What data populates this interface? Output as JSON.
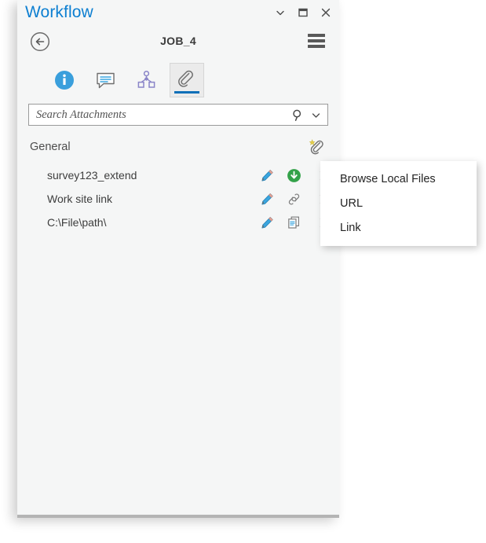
{
  "window": {
    "app_title": "Workflow",
    "controls": [
      {
        "name": "minimize",
        "glyph": "chevron-down"
      },
      {
        "name": "restore",
        "glyph": "square"
      },
      {
        "name": "close",
        "glyph": "x"
      }
    ]
  },
  "job_header": {
    "back_label": "Back",
    "job_title": "JOB_4",
    "menu_label": "Menu"
  },
  "tabs": [
    {
      "id": "information",
      "icon": "info-icon",
      "label": "Information",
      "active": false
    },
    {
      "id": "comments",
      "icon": "comment-icon",
      "label": "Comments",
      "active": false
    },
    {
      "id": "workflow",
      "icon": "workflow-diagram-icon",
      "label": "Workflow",
      "active": false
    },
    {
      "id": "attachments",
      "icon": "paperclip-icon",
      "label": "Attachments",
      "active": true
    }
  ],
  "search": {
    "placeholder": "Search Attachments",
    "value": "",
    "search_icon": "search-icon",
    "dropdown_icon": "chevron-down-icon"
  },
  "group": {
    "title": "General",
    "add_label": "Add Attachment",
    "add_icon": "add-attachment-paperclip-icon"
  },
  "attachments": [
    {
      "name": "survey123_extend",
      "type_icon": "download-icon",
      "edit_icon": "pencil-icon",
      "delete_icon": "close-icon"
    },
    {
      "name": "Work site link",
      "type_icon": "link-icon",
      "edit_icon": "pencil-icon",
      "delete_icon": "close-icon"
    },
    {
      "name": "C:\\File\\path\\",
      "type_icon": "copy-path-icon",
      "edit_icon": "pencil-icon",
      "delete_icon": "close-icon"
    }
  ],
  "context_menu": {
    "items": [
      {
        "label": "Browse Local Files"
      },
      {
        "label": "URL"
      },
      {
        "label": "Link"
      }
    ]
  },
  "colors": {
    "accent_blue": "#0d7fd1",
    "tab_underline": "#0d6fb8",
    "panel_bg": "#f5f6f6",
    "download_green": "#34a24a",
    "pencil_blue": "#3aa6e0",
    "workflow_purple": "#8a85c8",
    "star_gold": "#e8d14a"
  }
}
